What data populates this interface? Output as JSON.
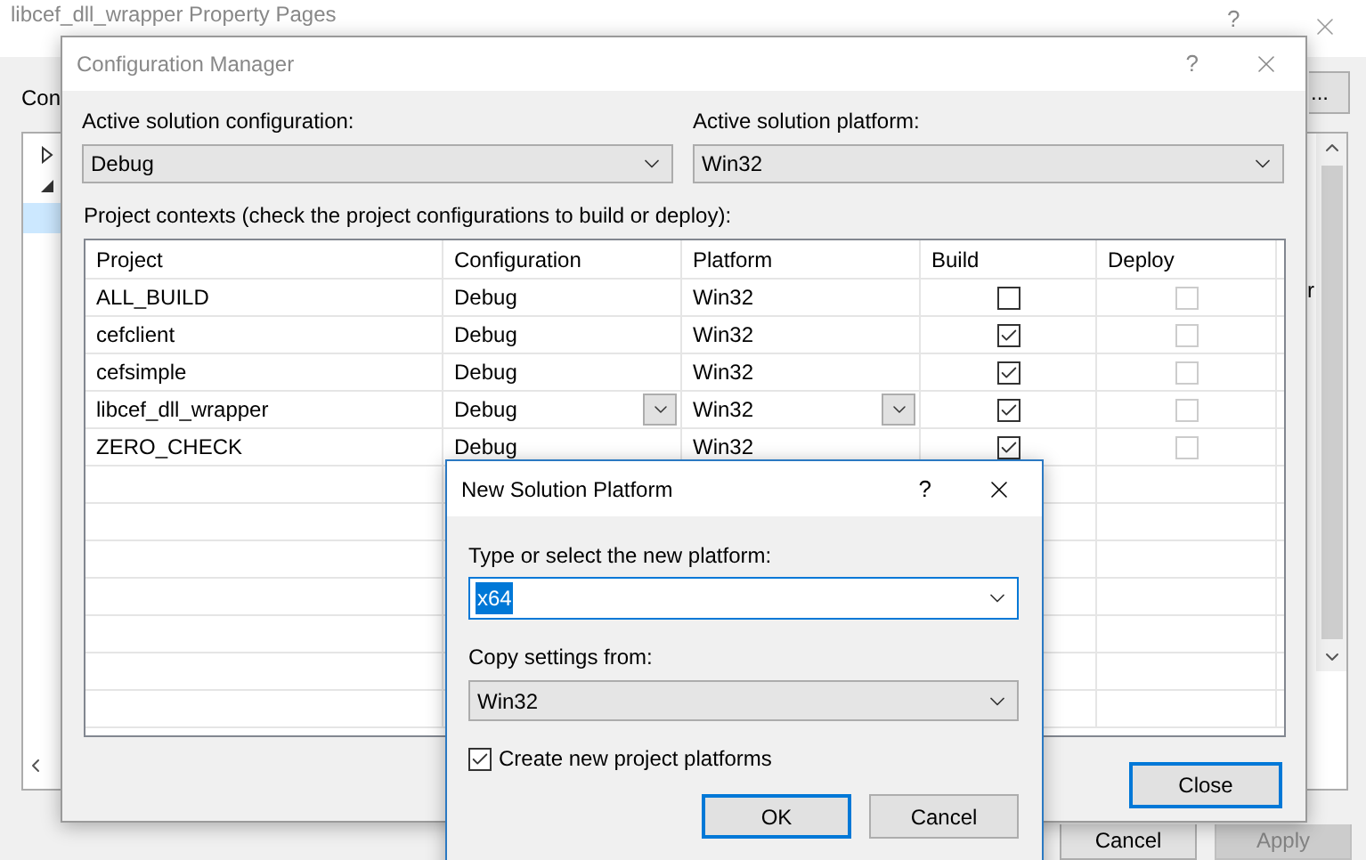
{
  "background_window": {
    "title": "libcef_dll_wrapper Property Pages",
    "help": "?",
    "label": "Con",
    "browse_button": "...",
    "partial_text": "r",
    "buttons": [
      {
        "label": "Cancel",
        "disabled": false
      },
      {
        "label": "Apply",
        "disabled": true
      }
    ]
  },
  "config_manager": {
    "title": "Configuration Manager",
    "help": "?",
    "active_configuration": {
      "label": "Active solution configuration:",
      "value": "Debug"
    },
    "active_platform": {
      "label": "Active solution platform:",
      "value": "Win32"
    },
    "contexts_label": "Project contexts (check the project configurations to build or deploy):",
    "table": {
      "columns": [
        "Project",
        "Configuration",
        "Platform",
        "Build",
        "Deploy"
      ],
      "rows": [
        {
          "project": "ALL_BUILD",
          "configuration": "Debug",
          "platform": "Win32",
          "build": false,
          "deploy": false,
          "deploy_disabled": true,
          "selected": false
        },
        {
          "project": "cefclient",
          "configuration": "Debug",
          "platform": "Win32",
          "build": true,
          "deploy": false,
          "deploy_disabled": true,
          "selected": false
        },
        {
          "project": "cefsimple",
          "configuration": "Debug",
          "platform": "Win32",
          "build": true,
          "deploy": false,
          "deploy_disabled": true,
          "selected": false
        },
        {
          "project": "libcef_dll_wrapper",
          "configuration": "Debug",
          "platform": "Win32",
          "build": true,
          "deploy": false,
          "deploy_disabled": true,
          "selected": true
        },
        {
          "project": "ZERO_CHECK",
          "configuration": "Debug",
          "platform": "Win32",
          "build": true,
          "deploy": false,
          "deploy_disabled": true,
          "selected": false
        }
      ]
    },
    "close_button": "Close"
  },
  "new_platform_dialog": {
    "title": "New Solution Platform",
    "help": "?",
    "platform_field": {
      "label": "Type or select the new platform:",
      "value": "x64"
    },
    "copy_from": {
      "label": "Copy settings from:",
      "value": "Win32"
    },
    "create_project_platforms": {
      "label": "Create new project platforms",
      "checked": true
    },
    "buttons": [
      {
        "label": "OK",
        "default": true
      },
      {
        "label": "Cancel",
        "default": false
      }
    ]
  }
}
